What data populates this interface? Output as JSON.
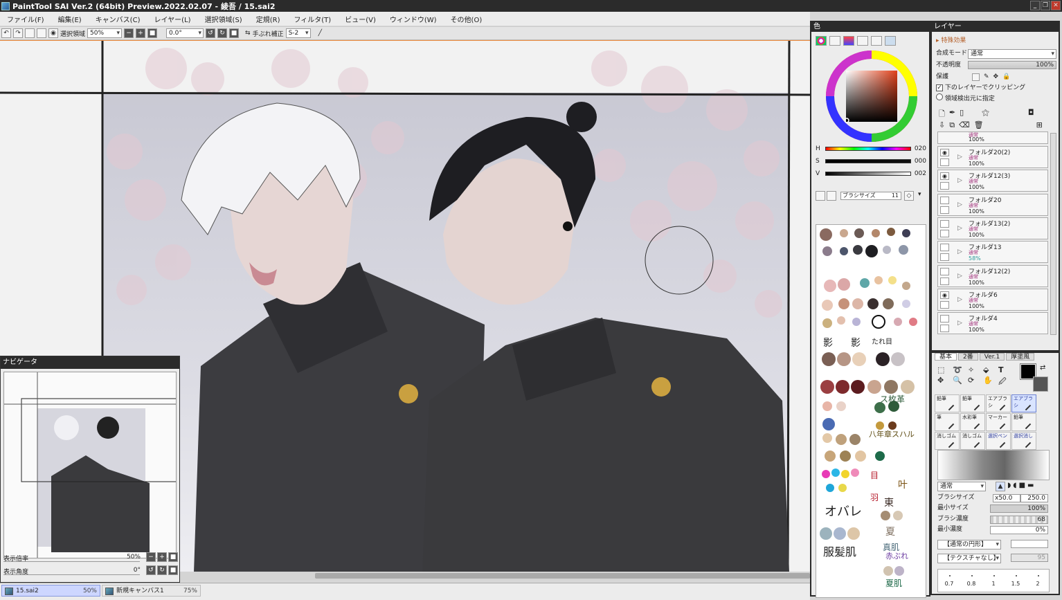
{
  "window": {
    "title": "PaintTool SAI Ver.2 (64bit) Preview.2022.02.07 - 綾吾 / 15.sai2"
  },
  "menu": [
    "ファイル(F)",
    "編集(E)",
    "キャンバス(C)",
    "レイヤー(L)",
    "選択領域(S)",
    "定規(R)",
    "フィルタ(T)",
    "ビュー(V)",
    "ウィンドウ(W)",
    "その他(O)"
  ],
  "toolbar": {
    "selection_label": "選択領域",
    "zoom_value": "50%",
    "rotation_value": "0.0°",
    "stabilizer_label": "手ぶれ補正",
    "stabilizer_value": "S-2"
  },
  "navigator": {
    "title": "ナビゲータ",
    "zoom_label": "表示倍率",
    "zoom_value": "50%",
    "angle_label": "表示角度",
    "angle_value": "0°"
  },
  "file_tabs": [
    {
      "name": "15.sai2",
      "zoom": "50%"
    },
    {
      "name": "新規キャンバス1",
      "zoom": "75%"
    }
  ],
  "color_panel": {
    "title": "色",
    "h_label": "H",
    "h_value": "020",
    "s_label": "S",
    "s_value": "000",
    "v_label": "V",
    "v_value": "002",
    "brush_size_label": "ブラシサイズ",
    "brush_size_value": "11",
    "handwritten_notes": [
      "影",
      "影",
      "たれ目",
      "ス枚革",
      "八年章スハル",
      "目",
      "叶",
      "羽",
      "東",
      "夏",
      "オバレ",
      "服髪肌",
      "真肌",
      "赤ぶれ",
      "夏肌"
    ]
  },
  "layer_panel": {
    "title": "レイヤー",
    "effects_label": "特殊効果",
    "blend_label": "合成モード",
    "blend_value": "通常",
    "opacity_label": "不透明度",
    "opacity_value": "100%",
    "protect_label": "保護",
    "clip_label": "下のレイヤーでクリッピング",
    "source_label": "領域検出元に指定",
    "top_partial": {
      "mode": "通常",
      "opacity": "100%"
    },
    "layers": [
      {
        "name": "フォルダ20(2)",
        "mode": "通常",
        "opacity": "100%",
        "visible": true
      },
      {
        "name": "フォルダ12(3)",
        "mode": "通常",
        "opacity": "100%",
        "visible": true
      },
      {
        "name": "フォルダ20",
        "mode": "通常",
        "opacity": "100%",
        "visible": false
      },
      {
        "name": "フォルダ13(2)",
        "mode": "通常",
        "opacity": "100%",
        "visible": false
      },
      {
        "name": "フォルダ13",
        "mode": "通常",
        "opacity": "58%",
        "visible": false
      },
      {
        "name": "フォルダ12(2)",
        "mode": "通常",
        "opacity": "100%",
        "visible": false
      },
      {
        "name": "フォルダ6",
        "mode": "通常",
        "opacity": "100%",
        "visible": true
      },
      {
        "name": "フォルダ4",
        "mode": "通常",
        "opacity": "100%",
        "visible": false
      }
    ]
  },
  "tool_panel": {
    "tabs": [
      "基本",
      "2番",
      "Ver.1",
      "厚塗風"
    ],
    "brushes": [
      {
        "label": "鉛筆",
        "selected": false,
        "blue": false
      },
      {
        "label": "鉛筆",
        "selected": false,
        "blue": false
      },
      {
        "label": "エアブラシ",
        "selected": false,
        "blue": false
      },
      {
        "label": "エアブラシ",
        "selected": true,
        "blue": true
      },
      {
        "label": "筆",
        "selected": false,
        "blue": false
      },
      {
        "label": "水彩筆",
        "selected": false,
        "blue": false
      },
      {
        "label": "マーカー",
        "selected": false,
        "blue": false
      },
      {
        "label": "鉛筆",
        "selected": false,
        "blue": false
      },
      {
        "label": "消しゴム",
        "selected": false,
        "blue": false
      },
      {
        "label": "消しゴム",
        "selected": false,
        "blue": false
      },
      {
        "label": "選択ペン",
        "selected": false,
        "blue": true
      },
      {
        "label": "選択消し",
        "selected": false,
        "blue": true
      }
    ],
    "blend_value": "通常",
    "brush_size_label": "ブラシサイズ",
    "brush_size_mult": "x50.0",
    "brush_size_value": "250.0",
    "min_size_label": "最小サイズ",
    "min_size_value": "100%",
    "density_label": "ブラシ濃度",
    "density_value": "68",
    "min_density_label": "最小濃度",
    "min_density_value": "0%",
    "shape_value": "【通常の円形】",
    "texture_value": "【テクスチャなし】",
    "texture_strength": "95",
    "size_presets": [
      "0.7",
      "0.8",
      "1",
      "1.5",
      "2"
    ]
  },
  "colors": {
    "titlebar": "#2b2b2b",
    "accent_orange": "#f08a3a",
    "uniform": "#3a3a3d",
    "button_gold": "#c9a040",
    "layer_mode": "#a0307a"
  }
}
